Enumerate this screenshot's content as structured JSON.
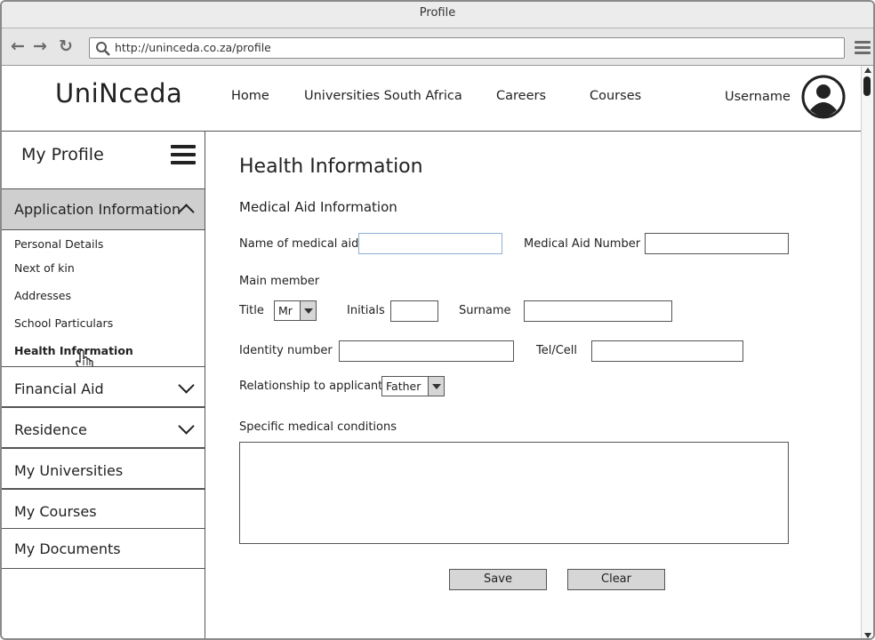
{
  "window": {
    "title": "Profile"
  },
  "browser": {
    "url": "http://uninceda.co.za/profile",
    "back_icon": "arrow-left",
    "forward_icon": "arrow-right",
    "reload_icon": "reload",
    "menu_icon": "hamburger"
  },
  "header": {
    "logo": "UniNceda",
    "nav": [
      "Home",
      "Universities South Africa",
      "Careers",
      "Courses"
    ],
    "username": "Username"
  },
  "sidebar": {
    "title": "My Profile",
    "sections": [
      {
        "label": "Application Information",
        "expanded": true
      },
      {
        "label": "Financial Aid",
        "expanded": false
      },
      {
        "label": "Residence",
        "expanded": false
      },
      {
        "label": "My Universities"
      },
      {
        "label": "My Courses"
      },
      {
        "label": "My Documents"
      }
    ],
    "sub_items": [
      "Personal Details",
      "Next of kin",
      "Addresses",
      "School Particulars",
      "Health Information"
    ],
    "active_sub_item": "Health Information"
  },
  "form": {
    "title": "Health Information",
    "section": "Medical Aid Information",
    "fields": {
      "medical_aid_name": "Name of medical aid",
      "medical_aid_number": "Medical Aid Number",
      "main_member": "Main member",
      "title": "Title",
      "title_value": "Mr",
      "initials": "Initials",
      "surname": "Surname",
      "identity_number": "Identity number",
      "tel_cell": "Tel/Cell",
      "relationship": "Relationship to applicant",
      "relationship_value": "Father",
      "conditions": "Specific medical conditions"
    },
    "buttons": {
      "save": "Save",
      "clear": "Clear"
    }
  },
  "colors": {
    "active_section_bg": "#cfcfcf",
    "focus_border": "#8fb1d6",
    "button_bg": "#d6d6d6",
    "chrome_bg": "#e6e6e6"
  }
}
